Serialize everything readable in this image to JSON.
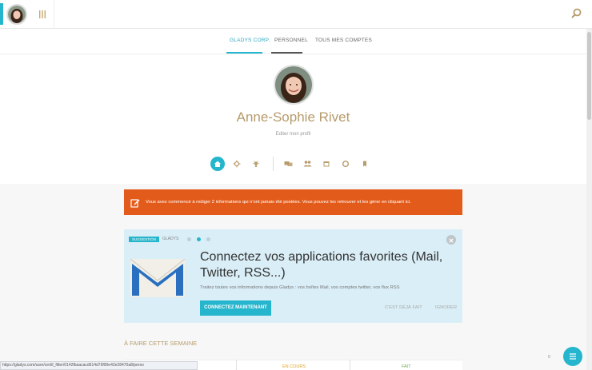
{
  "tabs": [
    "GLADYS CORP.",
    "PERSONNEL",
    "TOUS MES COMPTES"
  ],
  "profile": {
    "name": "Anne-Sophie Rivet",
    "edit_label": "Editer mon profil"
  },
  "icons": [
    "home-icon",
    "sun-icon",
    "lightbulb-icon",
    "chat-icon",
    "people-icon",
    "calendar-icon",
    "circle-icon",
    "bookmark-icon"
  ],
  "alert": {
    "text": "Vous avez commencé à rediger 2 informations qui n'ont jamais été postées. Vous pouvez les retrouver et les gérer en cliquant ici."
  },
  "suggestion": {
    "badge": "SUGGESTION",
    "source": "GLADYS",
    "title": "Connectez vos applications favorites (Mail, Twitter, RSS...)",
    "description": "Traitez toutes vos informations depuis Gladys : vos boîtes Mail, vos comptes twitter, vos flux RSS",
    "cta": "CONNECTEZ MAINTENANT",
    "done": "C'EST DÉJÀ FAIT",
    "ignore": "IGNORER",
    "active_dot": 2
  },
  "week": {
    "title": "À FAIRE CETTE SEMAINE",
    "col_en_cours": "EN COURS",
    "col_fait": "FAIT"
  },
  "status_url": "https://gladys.com/user/certif_filter/0142fbaacacd614d79f90e42e28470a8/perso",
  "badge_count": "0",
  "colors": {
    "accent": "#25b5cc",
    "alert": "#e35b1a",
    "name": "#b69b6b"
  }
}
